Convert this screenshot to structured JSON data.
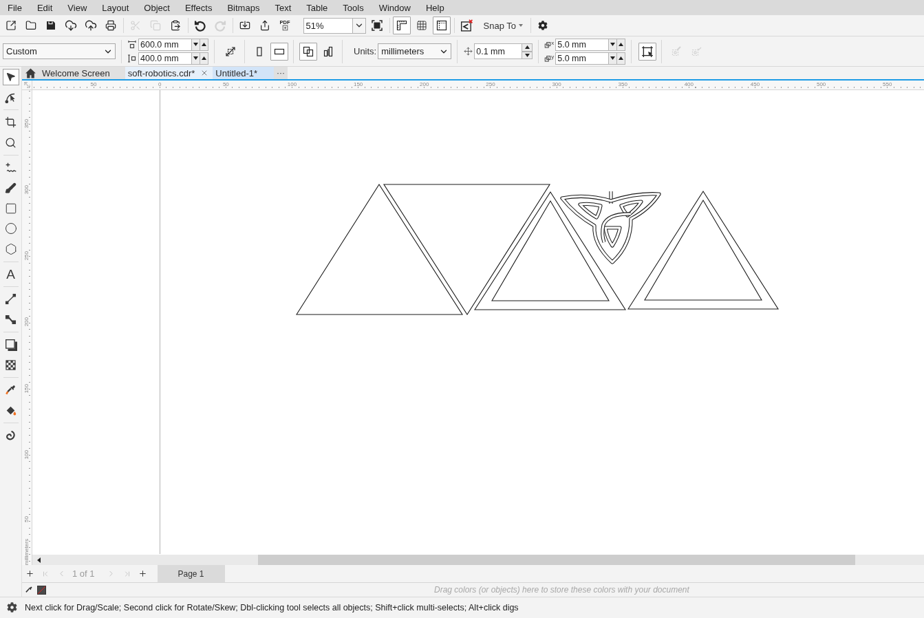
{
  "menu_bar": {
    "items": [
      "File",
      "Edit",
      "View",
      "Layout",
      "Object",
      "Effects",
      "Bitmaps",
      "Text",
      "Table",
      "Tools",
      "Window",
      "Help"
    ]
  },
  "standard_toolbar": {
    "groups": [
      [
        {
          "disabled": false
        },
        {
          "disabled": false
        },
        {
          "disabled": false
        },
        {
          "disabled": false
        },
        {
          "disabled": false
        },
        {
          "disabled": false
        }
      ],
      [
        {
          "disabled": true
        },
        {
          "disabled": true
        },
        {
          "disabled": false
        }
      ],
      [
        {
          "disabled": false
        },
        {
          "disabled": true
        }
      ],
      [
        {
          "disabled": false
        },
        {
          "disabled": false
        },
        {
          "disabled": false,
          "label": "PDF"
        }
      ]
    ],
    "zoom": {
      "value": "51%"
    },
    "view_toggles": [
      {
        "on": true
      },
      {
        "on": false
      },
      {
        "on": true
      }
    ],
    "snap_to": {
      "label": "Snap To"
    }
  },
  "property_bar": {
    "page_preset": {
      "value": "Custom"
    },
    "page_width": {
      "value": "600.0 mm"
    },
    "page_height": {
      "value": "400.0 mm"
    },
    "orientation": [
      {
        "selected": false
      },
      {
        "selected": true
      }
    ],
    "page_scope": [
      {
        "selected": true
      },
      {
        "selected": false
      }
    ],
    "units": {
      "label": "Units:",
      "value": "millimeters"
    },
    "nudge": {
      "value": "0.1 mm"
    },
    "duplicate_distance": [
      {
        "axis": "x",
        "value": "5.0 mm"
      },
      {
        "axis": "y",
        "value": "5.0 mm"
      }
    ],
    "trailing_buttons": [
      {
        "on": true,
        "disabled": false
      },
      {
        "on": false,
        "disabled": true
      },
      {
        "on": false,
        "disabled": true
      }
    ]
  },
  "toolbox": {
    "groups": [
      [
        {
          "selected": true
        },
        {
          "selected": false
        }
      ],
      [
        {
          "selected": false
        },
        {
          "selected": false
        }
      ],
      [
        {
          "selected": false
        },
        {
          "selected": false
        },
        {
          "selected": false
        },
        {
          "selected": false
        },
        {
          "selected": false
        }
      ],
      [
        {
          "selected": false,
          "glyph": "A"
        }
      ],
      [
        {
          "selected": false
        },
        {
          "selected": false
        }
      ],
      [
        {
          "selected": false
        },
        {
          "selected": false
        }
      ],
      [
        {
          "selected": false
        },
        {
          "selected": false
        }
      ],
      [
        {
          "selected": false
        }
      ]
    ]
  },
  "document_tabs": {
    "tabs": [
      {
        "kind": "home",
        "label": "Welcome Screen",
        "selected": false,
        "hovered": false
      },
      {
        "kind": "document",
        "label": "soft-robotics.cdr*",
        "selected": true,
        "hovered": false
      },
      {
        "kind": "document",
        "label": "Untitled-1*",
        "selected": false,
        "hovered": true
      }
    ],
    "more": {
      "label": "···"
    }
  },
  "rulers": {
    "horizontal": {
      "labels": [
        "50",
        "0",
        "50",
        "100",
        "150",
        "200",
        "250",
        "300",
        "350",
        "400",
        "450",
        "500",
        "550"
      ]
    },
    "vertical": {
      "labels": [
        "350",
        "300",
        "250",
        "200",
        "150",
        "100",
        "50"
      ],
      "unit": "millimeters"
    }
  },
  "canvas": {
    "objects": [
      {
        "kind": "triangle"
      },
      {
        "kind": "triangle"
      },
      {
        "kind": "triangle_frame"
      },
      {
        "kind": "knot"
      },
      {
        "kind": "triangle_frame"
      }
    ]
  },
  "page_navigator": {
    "leading_buttons": [
      {
        "kind": "add",
        "disabled": false
      },
      {
        "kind": "first",
        "disabled": true
      },
      {
        "kind": "previous",
        "disabled": true
      }
    ],
    "page_count": "1 of 1",
    "trailing_buttons": [
      {
        "kind": "next",
        "disabled": true
      },
      {
        "kind": "last",
        "disabled": true
      },
      {
        "kind": "add",
        "disabled": false
      }
    ],
    "pages": [
      {
        "label": "Page 1",
        "selected": true
      }
    ]
  },
  "document_palette": {
    "hint": "Drag colors (or objects) here to store these colors with your document"
  },
  "status_bar": {
    "message": "Next click for Drag/Scale; Second click for Rotate/Skew; Dbl-clicking tool selects all objects; Shift+click multi-selects; Alt+click digs"
  }
}
